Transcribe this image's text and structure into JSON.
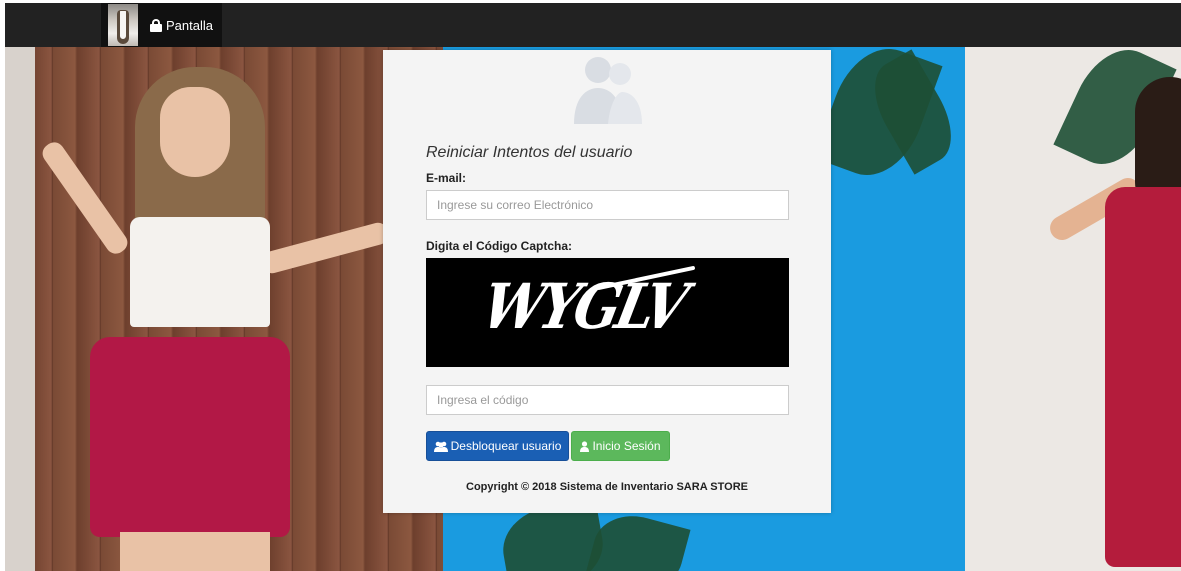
{
  "navbar": {
    "brand_label": "Pantalla"
  },
  "form": {
    "title": "Reiniciar Intentos del usuario",
    "email_label": "E-mail:",
    "email_placeholder": "Ingrese su correo Electrónico",
    "captcha_label": "Digita el Código Captcha:",
    "captcha_text": "WYGLV",
    "code_placeholder": "Ingresa el código",
    "unlock_button": "Desbloquear usuario",
    "login_button": "Inicio Sesión"
  },
  "footer": {
    "prefix": "Copyright © 2018 ",
    "brand": "Sistema de Inventario SARA STORE"
  },
  "colors": {
    "navbar": "#222222",
    "primary_button": "#1a5fb4",
    "success_button": "#5cb85c",
    "background_blue": "#1a9be0"
  },
  "icons": {
    "brand": "lock-icon",
    "avatar": "users-silhouette-icon",
    "unlock_button": "users-icon",
    "login_button": "user-icon"
  }
}
